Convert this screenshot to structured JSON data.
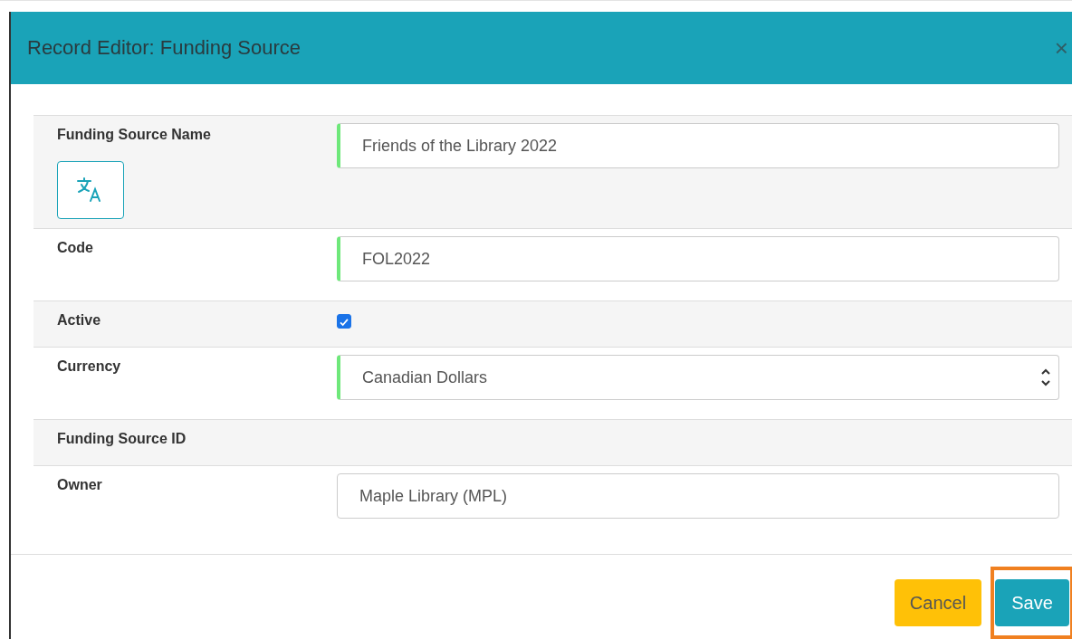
{
  "dialog": {
    "title": "Record Editor: Funding Source",
    "close": "×"
  },
  "fields": [
    {
      "kind": "text",
      "label": "Funding Source Name",
      "value": "Friends of the Library 2022",
      "required": true,
      "translate": true
    },
    {
      "kind": "text",
      "label": "Code",
      "value": "FOL2022",
      "required": true,
      "translate": false
    },
    {
      "kind": "checkbox",
      "label": "Active",
      "checked": true
    },
    {
      "kind": "select",
      "label": "Currency",
      "value": "Canadian Dollars",
      "required": true
    },
    {
      "kind": "empty",
      "label": "Funding Source ID"
    },
    {
      "kind": "text",
      "label": "Owner",
      "value": "Maple Library (MPL)",
      "required": false,
      "translate": false
    }
  ],
  "buttons": [
    {
      "kind": "cancel",
      "label": "Cancel",
      "highlighted": false
    },
    {
      "kind": "save",
      "label": "Save",
      "highlighted": true
    }
  ]
}
